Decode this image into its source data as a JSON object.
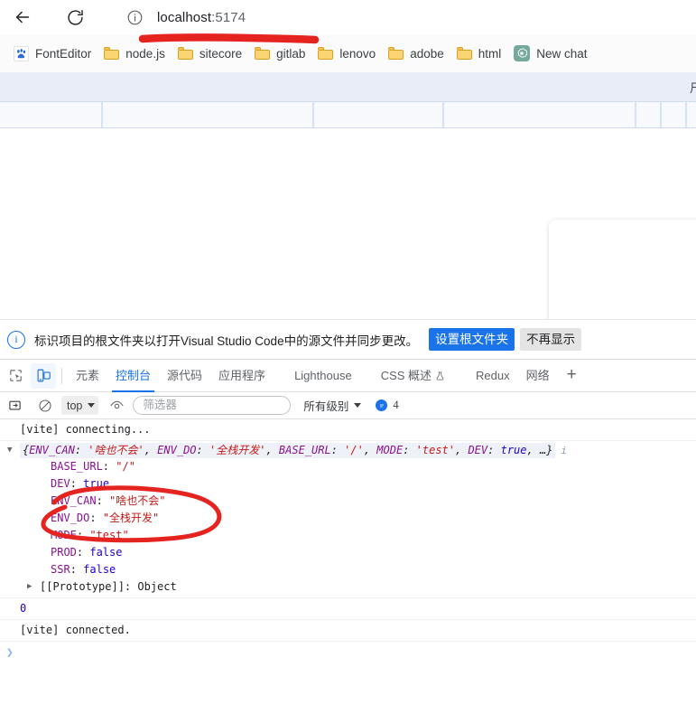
{
  "browser": {
    "back_label": "Back",
    "reload_label": "Reload",
    "info_icon": "info-circle-icon",
    "url_host": "localhost",
    "url_port": ":5174",
    "bookmarks": [
      {
        "label": "FontEditor",
        "icon": "baidu-icon"
      },
      {
        "label": "node.js",
        "icon": "folder-icon"
      },
      {
        "label": "sitecore",
        "icon": "folder-icon"
      },
      {
        "label": "gitlab",
        "icon": "folder-icon"
      },
      {
        "label": "lenovo",
        "icon": "folder-icon"
      },
      {
        "label": "adobe",
        "icon": "folder-icon"
      },
      {
        "label": "html",
        "icon": "folder-icon"
      },
      {
        "label": "New chat",
        "icon": "openai-icon"
      }
    ]
  },
  "page": {
    "grid_header_text": "尺",
    "columns": [
      114,
      234,
      358,
      138,
      30,
      30,
      40
    ],
    "card_name": "empty-content-card"
  },
  "infobar": {
    "icon": "info-circle-icon",
    "message": "标识项目的根文件夹以打开Visual Studio Code中的源文件并同步更改。",
    "primary_button": "设置根文件夹",
    "secondary_button": "不再显示"
  },
  "devtools": {
    "inspect_icon": "inspect-element-icon",
    "device_icon": "device-toolbar-icon",
    "tabs": [
      {
        "label": "元素",
        "active": false
      },
      {
        "label": "控制台",
        "active": true
      },
      {
        "label": "源代码",
        "active": false
      },
      {
        "label": "应用程序",
        "active": false
      },
      {
        "label": "Lighthouse",
        "active": false
      },
      {
        "label": "CSS 概述",
        "active": false,
        "icon": "flask-icon"
      },
      {
        "label": "Redux",
        "active": false
      },
      {
        "label": "网络",
        "active": false
      }
    ],
    "add_tab_label": "+",
    "console_toolbar": {
      "sidebar_icon": "console-sidebar-icon",
      "clear_icon": "clear-console-icon",
      "context_value": "top",
      "eye_icon": "live-expression-icon",
      "filter_placeholder": "筛选器",
      "filter_value": "",
      "level_value": "所有级别",
      "badge_icon": "message-badge-icon",
      "badge_count": "4"
    },
    "console_messages": [
      {
        "type": "log",
        "text": "[vite] connecting..."
      },
      {
        "type": "object",
        "preview_parts": [
          {
            "t": "punct",
            "v": "{"
          },
          {
            "t": "key",
            "v": "ENV_CAN"
          },
          {
            "t": "punct",
            "v": ": "
          },
          {
            "t": "str",
            "v": "'啥也不会'"
          },
          {
            "t": "punct",
            "v": ", "
          },
          {
            "t": "key",
            "v": "ENV_DO"
          },
          {
            "t": "punct",
            "v": ": "
          },
          {
            "t": "str",
            "v": "'全栈开发'"
          },
          {
            "t": "punct",
            "v": ", "
          },
          {
            "t": "key",
            "v": "BASE_URL"
          },
          {
            "t": "punct",
            "v": ": "
          },
          {
            "t": "str",
            "v": "'/'"
          },
          {
            "t": "punct",
            "v": ", "
          },
          {
            "t": "key",
            "v": "MODE"
          },
          {
            "t": "punct",
            "v": ": "
          },
          {
            "t": "str",
            "v": "'test'"
          },
          {
            "t": "punct",
            "v": ", "
          },
          {
            "t": "key",
            "v": "DEV"
          },
          {
            "t": "punct",
            "v": ": "
          },
          {
            "t": "bool",
            "v": "true"
          },
          {
            "t": "punct",
            "v": ", …}"
          }
        ],
        "info_marker": "i",
        "properties": [
          {
            "key": "BASE_URL",
            "value": "\"/\"",
            "kind": "string"
          },
          {
            "key": "DEV",
            "value": "true",
            "kind": "bool"
          },
          {
            "key": "ENV_CAN",
            "value": "\"啥也不会\"",
            "kind": "string"
          },
          {
            "key": "ENV_DO",
            "value": "\"全栈开发\"",
            "kind": "string"
          },
          {
            "key": "MODE",
            "value": "\"test\"",
            "kind": "string"
          },
          {
            "key": "PROD",
            "value": "false",
            "kind": "bool"
          },
          {
            "key": "SSR",
            "value": "false",
            "kind": "bool"
          }
        ],
        "prototype_label": "[[Prototype]]: Object"
      },
      {
        "type": "number",
        "text": "0"
      },
      {
        "type": "log",
        "text": "[vite] connected."
      }
    ],
    "prompt_symbol": ">"
  },
  "annotations": {
    "underline_name": "red-underline-stroke",
    "circle_name": "red-circle-stroke",
    "color": "#e5231f"
  }
}
